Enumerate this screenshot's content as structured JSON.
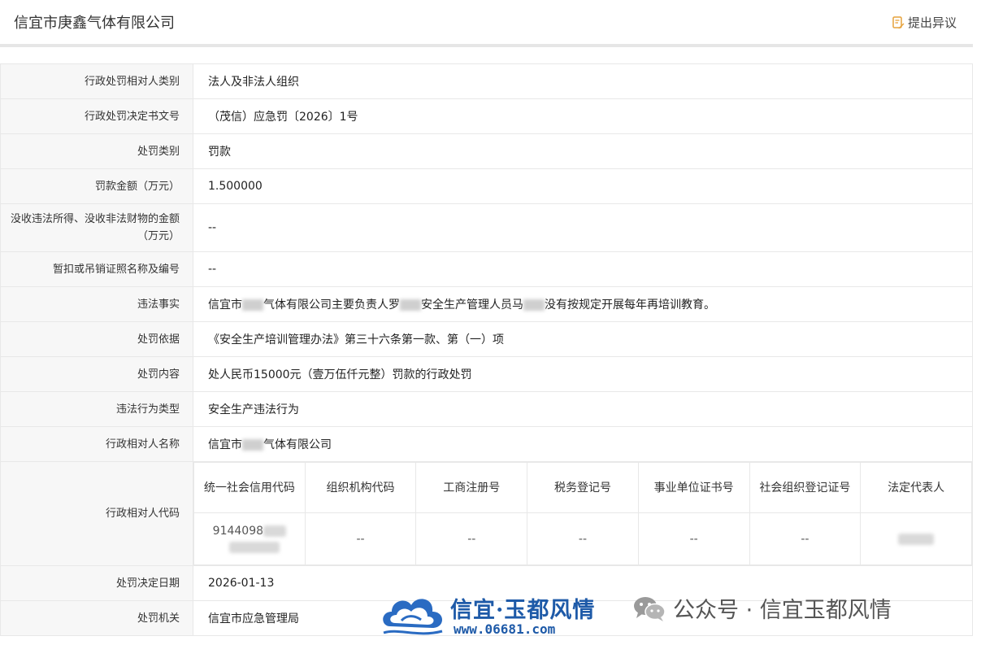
{
  "header": {
    "company_name": "信宜市庚鑫气体有限公司",
    "objection_label": "提出异议"
  },
  "rows": [
    {
      "label": "行政处罚相对人类别",
      "value": "法人及非法人组织"
    },
    {
      "label": "行政处罚决定书文号",
      "value": "（茂信）应急罚〔2026〕1号"
    },
    {
      "label": "处罚类别",
      "value": "罚款"
    },
    {
      "label": "罚款金额（万元）",
      "value": "1.500000"
    },
    {
      "label": "没收违法所得、没收非法财物的金额（万元）",
      "value": "--"
    },
    {
      "label": "暂扣或吊销证照名称及编号",
      "value": "--"
    },
    {
      "label": "违法事实",
      "value_parts": [
        "信宜市",
        "气体有限公司主要负责人罗",
        "安全生产管理人员马",
        "没有按规定开展每年再培训教育。"
      ]
    },
    {
      "label": "处罚依据",
      "value": "《安全生产培训管理办法》第三十六条第一款、第（一）项"
    },
    {
      "label": "处罚内容",
      "value": "处人民币15000元（壹万伍仟元整）罚款的行政处罚"
    },
    {
      "label": "违法行为类型",
      "value": "安全生产违法行为"
    },
    {
      "label": "行政相对人名称",
      "value_parts": [
        "信宜市",
        "气体有限公司"
      ]
    }
  ],
  "code_section": {
    "label": "行政相对人代码",
    "headers": [
      "统一社会信用代码",
      "组织机构代码",
      "工商注册号",
      "税务登记号",
      "事业单位证书号",
      "社会组织登记证号",
      "法定代表人"
    ],
    "values": [
      "9144098",
      "--",
      "--",
      "--",
      "--",
      "--",
      ""
    ]
  },
  "bottom_rows": [
    {
      "label": "处罚决定日期",
      "value": "2026-01-13"
    },
    {
      "label": "处罚机关",
      "value": "信宜市应急管理局"
    }
  ],
  "watermark": {
    "site_title": "信宜·玉都风情",
    "site_url": "www.06681.com",
    "wechat_text": "公众号 · 信宜玉都风情"
  },
  "colors": {
    "label_bg": "#f7f7f7",
    "border": "#e8e8e8",
    "watermark_blue": "#1e5aa8"
  }
}
